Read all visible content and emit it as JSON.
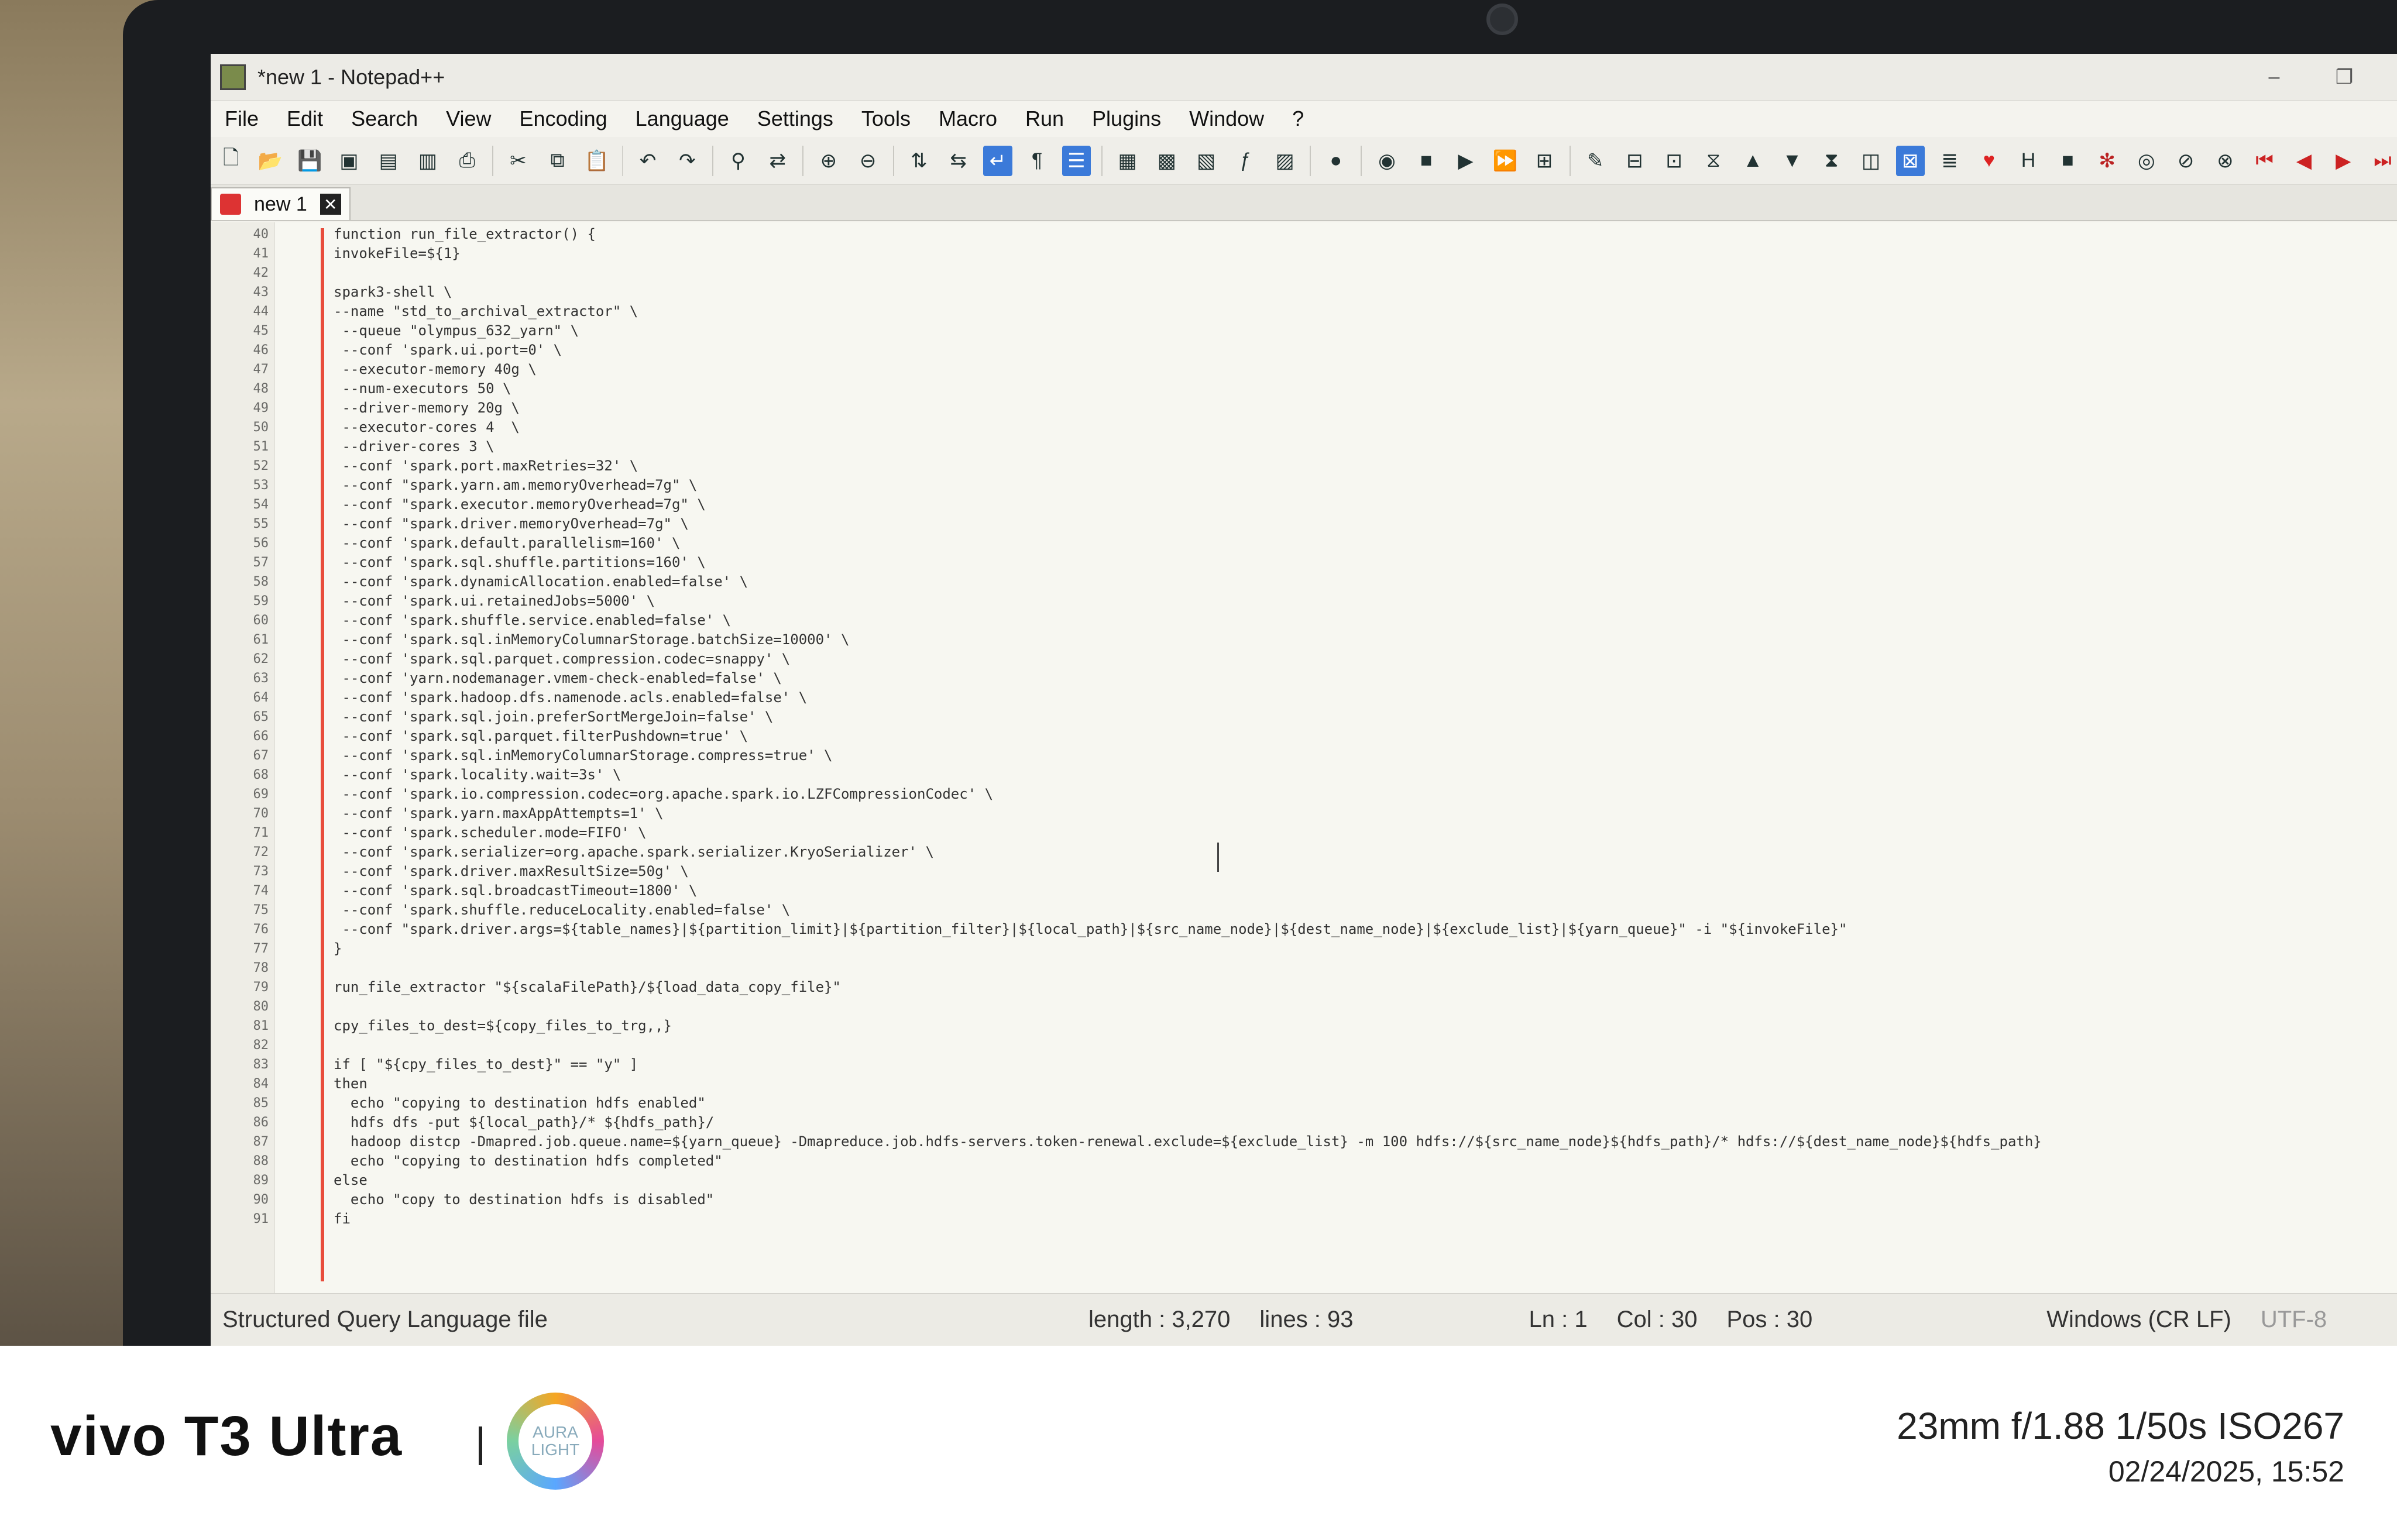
{
  "window": {
    "title": "*new 1 - Notepad++"
  },
  "menu": [
    "File",
    "Edit",
    "Search",
    "View",
    "Encoding",
    "Language",
    "Settings",
    "Tools",
    "Macro",
    "Run",
    "Plugins",
    "Window",
    "?"
  ],
  "tab": {
    "label": "new 1",
    "close": "✕"
  },
  "editor": {
    "line_numbers": [
      "40",
      "41",
      "42",
      "43",
      "44",
      "45",
      "46",
      "47",
      "48",
      "49",
      "50",
      "51",
      "52",
      "53",
      "54",
      "55",
      "56",
      "57",
      "58",
      "59",
      "60",
      "61",
      "62",
      "63",
      "64",
      "65",
      "66",
      "67",
      "68",
      "69",
      "70",
      "71",
      "72",
      "73",
      "74",
      "75",
      "76",
      "77",
      "78",
      "79",
      "80",
      "81",
      "82",
      "83",
      "84",
      "85",
      "86",
      "87",
      "88",
      "89",
      "90",
      "91"
    ],
    "lines": [
      "function run_file_extractor() {",
      "invokeFile=${1}",
      "",
      "spark3-shell \\",
      "--name \"std_to_archival_extractor\" \\",
      " --queue \"olympus_632_yarn\" \\",
      " --conf 'spark.ui.port=0' \\",
      " --executor-memory 40g \\",
      " --num-executors 50 \\",
      " --driver-memory 20g \\",
      " --executor-cores 4  \\",
      " --driver-cores 3 \\",
      " --conf 'spark.port.maxRetries=32' \\",
      " --conf \"spark.yarn.am.memoryOverhead=7g\" \\",
      " --conf \"spark.executor.memoryOverhead=7g\" \\",
      " --conf \"spark.driver.memoryOverhead=7g\" \\",
      " --conf 'spark.default.parallelism=160' \\",
      " --conf 'spark.sql.shuffle.partitions=160' \\",
      " --conf 'spark.dynamicAllocation.enabled=false' \\",
      " --conf 'spark.ui.retainedJobs=5000' \\",
      " --conf 'spark.shuffle.service.enabled=false' \\",
      " --conf 'spark.sql.inMemoryColumnarStorage.batchSize=10000' \\",
      " --conf 'spark.sql.parquet.compression.codec=snappy' \\",
      " --conf 'yarn.nodemanager.vmem-check-enabled=false' \\",
      " --conf 'spark.hadoop.dfs.namenode.acls.enabled=false' \\",
      " --conf 'spark.sql.join.preferSortMergeJoin=false' \\",
      " --conf 'spark.sql.parquet.filterPushdown=true' \\",
      " --conf 'spark.sql.inMemoryColumnarStorage.compress=true' \\",
      " --conf 'spark.locality.wait=3s' \\",
      " --conf 'spark.io.compression.codec=org.apache.spark.io.LZFCompressionCodec' \\",
      " --conf 'spark.yarn.maxAppAttempts=1' \\",
      " --conf 'spark.scheduler.mode=FIFO' \\",
      " --conf 'spark.serializer=org.apache.spark.serializer.KryoSerializer' \\",
      " --conf 'spark.driver.maxResultSize=50g' \\",
      " --conf 'spark.sql.broadcastTimeout=1800' \\",
      " --conf 'spark.shuffle.reduceLocality.enabled=false' \\",
      " --conf \"spark.driver.args=${table_names}|${partition_limit}|${partition_filter}|${local_path}|${src_name_node}|${dest_name_node}|${exclude_list}|${yarn_queue}\" -i \"${invokeFile}\"",
      "}",
      "",
      "run_file_extractor \"${scalaFilePath}/${load_data_copy_file}\"",
      "",
      "cpy_files_to_dest=${copy_files_to_trg,,}",
      "",
      "if [ \"${cpy_files_to_dest}\" == \"y\" ]",
      "then",
      "  echo \"copying to destination hdfs enabled\"",
      "  hdfs dfs -put ${local_path}/* ${hdfs_path}/",
      "  hadoop distcp -Dmapred.job.queue.name=${yarn_queue} -Dmapreduce.job.hdfs-servers.token-renewal.exclude=${exclude_list} -m 100 hdfs://${src_name_node}${hdfs_path}/* hdfs://${dest_name_node}${hdfs_path}",
      "  echo \"copying to destination hdfs completed\"",
      "else",
      "  echo \"copy to destination hdfs is disabled\"",
      "fi"
    ]
  },
  "statusbar": {
    "language": "Structured Query Language file",
    "length": "length : 3,270",
    "lines": "lines : 93",
    "ln": "Ln : 1",
    "col": "Col : 30",
    "pos": "Pos : 30",
    "eol": "Windows (CR LF)",
    "encoding": "UTF-8"
  },
  "camera": {
    "brand": "vivo T3 Ultra",
    "aura_line1": "AURA",
    "aura_line2": "LIGHT",
    "exif": "23mm  f/1.88  1/50s  ISO267",
    "datetime": "02/24/2025, 15:52"
  },
  "colors": {
    "fold_line": "#e84d3c",
    "tab_icon": "#dd3333",
    "toolbar_active": "#3b7ad9"
  }
}
